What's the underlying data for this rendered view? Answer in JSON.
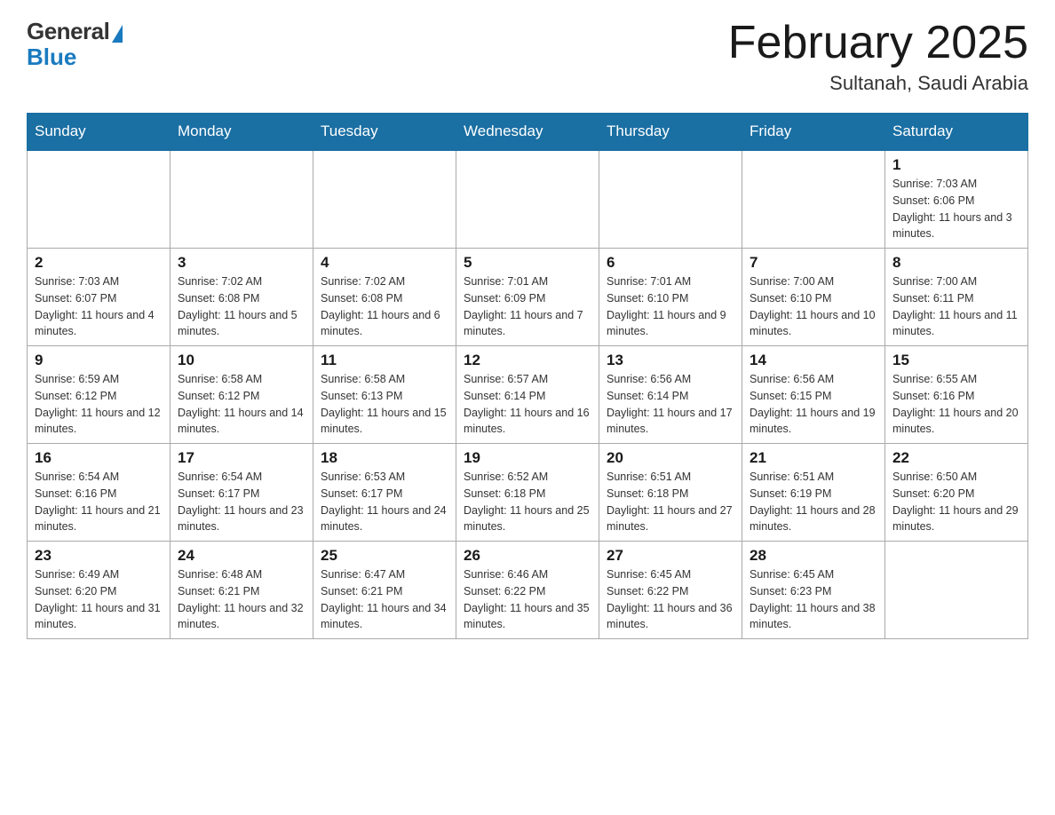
{
  "header": {
    "logo_general": "General",
    "logo_blue": "Blue",
    "month_title": "February 2025",
    "location": "Sultanah, Saudi Arabia"
  },
  "days_of_week": [
    "Sunday",
    "Monday",
    "Tuesday",
    "Wednesday",
    "Thursday",
    "Friday",
    "Saturday"
  ],
  "weeks": [
    [
      {
        "day": "",
        "sunrise": "",
        "sunset": "",
        "daylight": ""
      },
      {
        "day": "",
        "sunrise": "",
        "sunset": "",
        "daylight": ""
      },
      {
        "day": "",
        "sunrise": "",
        "sunset": "",
        "daylight": ""
      },
      {
        "day": "",
        "sunrise": "",
        "sunset": "",
        "daylight": ""
      },
      {
        "day": "",
        "sunrise": "",
        "sunset": "",
        "daylight": ""
      },
      {
        "day": "",
        "sunrise": "",
        "sunset": "",
        "daylight": ""
      },
      {
        "day": "1",
        "sunrise": "Sunrise: 7:03 AM",
        "sunset": "Sunset: 6:06 PM",
        "daylight": "Daylight: 11 hours and 3 minutes."
      }
    ],
    [
      {
        "day": "2",
        "sunrise": "Sunrise: 7:03 AM",
        "sunset": "Sunset: 6:07 PM",
        "daylight": "Daylight: 11 hours and 4 minutes."
      },
      {
        "day": "3",
        "sunrise": "Sunrise: 7:02 AM",
        "sunset": "Sunset: 6:08 PM",
        "daylight": "Daylight: 11 hours and 5 minutes."
      },
      {
        "day": "4",
        "sunrise": "Sunrise: 7:02 AM",
        "sunset": "Sunset: 6:08 PM",
        "daylight": "Daylight: 11 hours and 6 minutes."
      },
      {
        "day": "5",
        "sunrise": "Sunrise: 7:01 AM",
        "sunset": "Sunset: 6:09 PM",
        "daylight": "Daylight: 11 hours and 7 minutes."
      },
      {
        "day": "6",
        "sunrise": "Sunrise: 7:01 AM",
        "sunset": "Sunset: 6:10 PM",
        "daylight": "Daylight: 11 hours and 9 minutes."
      },
      {
        "day": "7",
        "sunrise": "Sunrise: 7:00 AM",
        "sunset": "Sunset: 6:10 PM",
        "daylight": "Daylight: 11 hours and 10 minutes."
      },
      {
        "day": "8",
        "sunrise": "Sunrise: 7:00 AM",
        "sunset": "Sunset: 6:11 PM",
        "daylight": "Daylight: 11 hours and 11 minutes."
      }
    ],
    [
      {
        "day": "9",
        "sunrise": "Sunrise: 6:59 AM",
        "sunset": "Sunset: 6:12 PM",
        "daylight": "Daylight: 11 hours and 12 minutes."
      },
      {
        "day": "10",
        "sunrise": "Sunrise: 6:58 AM",
        "sunset": "Sunset: 6:12 PM",
        "daylight": "Daylight: 11 hours and 14 minutes."
      },
      {
        "day": "11",
        "sunrise": "Sunrise: 6:58 AM",
        "sunset": "Sunset: 6:13 PM",
        "daylight": "Daylight: 11 hours and 15 minutes."
      },
      {
        "day": "12",
        "sunrise": "Sunrise: 6:57 AM",
        "sunset": "Sunset: 6:14 PM",
        "daylight": "Daylight: 11 hours and 16 minutes."
      },
      {
        "day": "13",
        "sunrise": "Sunrise: 6:56 AM",
        "sunset": "Sunset: 6:14 PM",
        "daylight": "Daylight: 11 hours and 17 minutes."
      },
      {
        "day": "14",
        "sunrise": "Sunrise: 6:56 AM",
        "sunset": "Sunset: 6:15 PM",
        "daylight": "Daylight: 11 hours and 19 minutes."
      },
      {
        "day": "15",
        "sunrise": "Sunrise: 6:55 AM",
        "sunset": "Sunset: 6:16 PM",
        "daylight": "Daylight: 11 hours and 20 minutes."
      }
    ],
    [
      {
        "day": "16",
        "sunrise": "Sunrise: 6:54 AM",
        "sunset": "Sunset: 6:16 PM",
        "daylight": "Daylight: 11 hours and 21 minutes."
      },
      {
        "day": "17",
        "sunrise": "Sunrise: 6:54 AM",
        "sunset": "Sunset: 6:17 PM",
        "daylight": "Daylight: 11 hours and 23 minutes."
      },
      {
        "day": "18",
        "sunrise": "Sunrise: 6:53 AM",
        "sunset": "Sunset: 6:17 PM",
        "daylight": "Daylight: 11 hours and 24 minutes."
      },
      {
        "day": "19",
        "sunrise": "Sunrise: 6:52 AM",
        "sunset": "Sunset: 6:18 PM",
        "daylight": "Daylight: 11 hours and 25 minutes."
      },
      {
        "day": "20",
        "sunrise": "Sunrise: 6:51 AM",
        "sunset": "Sunset: 6:18 PM",
        "daylight": "Daylight: 11 hours and 27 minutes."
      },
      {
        "day": "21",
        "sunrise": "Sunrise: 6:51 AM",
        "sunset": "Sunset: 6:19 PM",
        "daylight": "Daylight: 11 hours and 28 minutes."
      },
      {
        "day": "22",
        "sunrise": "Sunrise: 6:50 AM",
        "sunset": "Sunset: 6:20 PM",
        "daylight": "Daylight: 11 hours and 29 minutes."
      }
    ],
    [
      {
        "day": "23",
        "sunrise": "Sunrise: 6:49 AM",
        "sunset": "Sunset: 6:20 PM",
        "daylight": "Daylight: 11 hours and 31 minutes."
      },
      {
        "day": "24",
        "sunrise": "Sunrise: 6:48 AM",
        "sunset": "Sunset: 6:21 PM",
        "daylight": "Daylight: 11 hours and 32 minutes."
      },
      {
        "day": "25",
        "sunrise": "Sunrise: 6:47 AM",
        "sunset": "Sunset: 6:21 PM",
        "daylight": "Daylight: 11 hours and 34 minutes."
      },
      {
        "day": "26",
        "sunrise": "Sunrise: 6:46 AM",
        "sunset": "Sunset: 6:22 PM",
        "daylight": "Daylight: 11 hours and 35 minutes."
      },
      {
        "day": "27",
        "sunrise": "Sunrise: 6:45 AM",
        "sunset": "Sunset: 6:22 PM",
        "daylight": "Daylight: 11 hours and 36 minutes."
      },
      {
        "day": "28",
        "sunrise": "Sunrise: 6:45 AM",
        "sunset": "Sunset: 6:23 PM",
        "daylight": "Daylight: 11 hours and 38 minutes."
      },
      {
        "day": "",
        "sunrise": "",
        "sunset": "",
        "daylight": ""
      }
    ]
  ]
}
